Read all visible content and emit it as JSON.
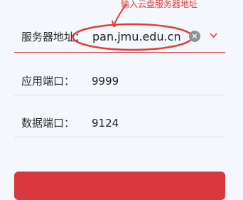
{
  "annotation": {
    "text": "输入云盘服务器地址",
    "color": "#e33c3c"
  },
  "form": {
    "server": {
      "label": "服务器地址：",
      "value": "pan.jmu.edu.cn",
      "clear_icon": "clear-icon",
      "dropdown_icon": "chevron-down-icon"
    },
    "port": {
      "label": "应用端口：",
      "value": "9999"
    },
    "data_port": {
      "label": "数据端口：",
      "value": "9124"
    }
  },
  "colors": {
    "accent": "#d9383f",
    "background": "#f4f8fd",
    "divider": "#d7dade",
    "icon_gray": "#8f9194"
  }
}
